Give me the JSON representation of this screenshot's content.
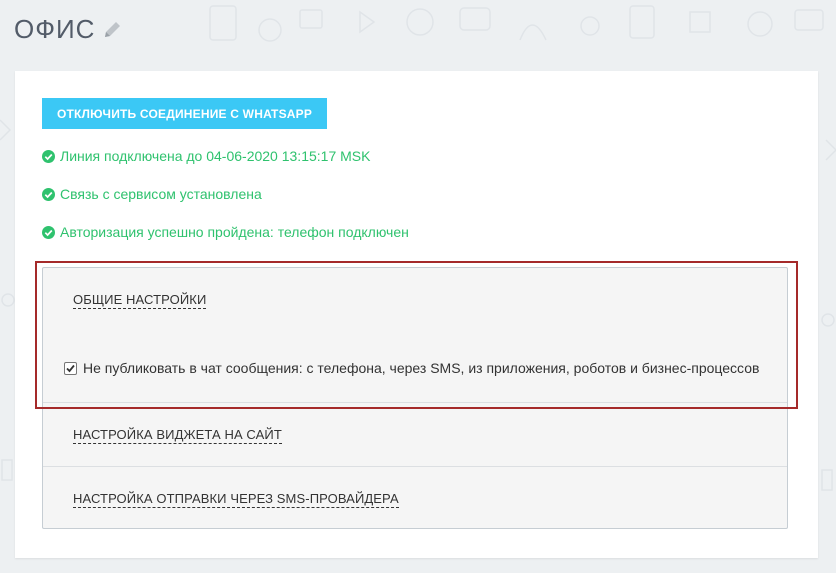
{
  "header": {
    "title": "ОФИС",
    "edit_icon": "pencil-icon"
  },
  "card": {
    "disconnect_button": "ОТКЛЮЧИТЬ СОЕДИНЕНИЕ С WHATSAPP",
    "status_lines": [
      {
        "icon": "check-circle-icon",
        "text": "Линия подключена до 04-06-2020 13:15:17 MSK"
      },
      {
        "icon": "check-circle-icon",
        "text": "Связь с сервисом установлена"
      },
      {
        "icon": "check-circle-icon",
        "text": "Авторизация успешно пройдена: телефон подключен"
      }
    ],
    "sections": {
      "general": {
        "title": "ОБЩИЕ НАСТРОЙКИ",
        "checkbox_label": "Не публиковать в чат сообщения: с телефона, через SMS, из приложения, роботов и бизнес-процессов",
        "checkbox_checked": true
      },
      "widget": {
        "title": "НАСТРОЙКА ВИДЖЕТА НА САЙТ"
      },
      "sms": {
        "title": "НАСТРОЙКА ОТПРАВКИ ЧЕРЕЗ SMS-ПРОВАЙДЕРА"
      }
    }
  },
  "colors": {
    "accent_button": "#3bc8f5",
    "status_green": "#2fc26e",
    "highlight_border": "#a52a2a"
  }
}
